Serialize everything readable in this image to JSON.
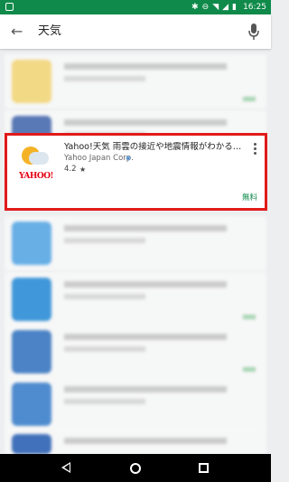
{
  "status_bar": {
    "time": "16:25",
    "icons": [
      "bluetooth-icon",
      "do-not-disturb-icon",
      "wifi-icon",
      "signal-icon",
      "battery-icon"
    ]
  },
  "search": {
    "query": "天気"
  },
  "featured_app": {
    "title": "Yahoo!天気 雨雲の接近や地震情報がわかる天気予報アプリ",
    "developer": "Yahoo Japan Corp.",
    "rating": "4.2",
    "star": "★",
    "price": "無料",
    "icon_logo": "YAHOO!"
  },
  "colors": {
    "status_bar": "#0f8a4a",
    "highlight": "#e11a1a",
    "price_green": "#0f8a4a"
  }
}
